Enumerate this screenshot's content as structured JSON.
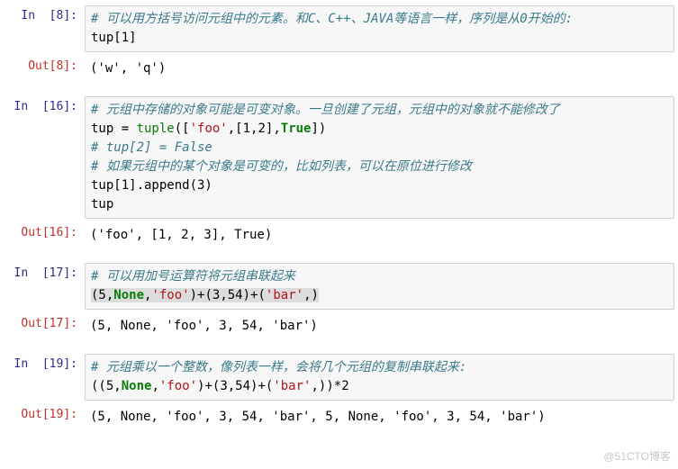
{
  "cells": {
    "c8": {
      "in_prompt": "In  [8]:",
      "out_prompt": "Out[8]:",
      "comment1": "# 可以用方括号访问元组中的元素。和C、C++、JAVA等语言一样，序列是从0开始的:",
      "line2": "tup[1]",
      "output": "('w', 'q')"
    },
    "c16": {
      "in_prompt": "In  [16]:",
      "out_prompt": "Out[16]:",
      "comment1": "# 元组中存储的对象可能是可变对象。一旦创建了元组，元组中的对象就不能修改了",
      "line2_a": "tup = ",
      "line2_func": "tuple",
      "line2_b": "([",
      "line2_str": "'foo'",
      "line2_c": ",[1,2],",
      "line2_true": "True",
      "line2_d": "])",
      "comment2": "# tup[2] = False",
      "comment3": "# 如果元组中的某个对象是可变的，比如列表，可以在原位进行修改",
      "line5": "tup[1].append(3)",
      "line6": "tup",
      "output": "('foo', [1, 2, 3], True)"
    },
    "c17": {
      "in_prompt": "In  [17]:",
      "out_prompt": "Out[17]:",
      "comment1": "# 可以用加号运算符将元组串联起来",
      "l2_a": "(5,",
      "l2_none": "None",
      "l2_b": ",",
      "l2_str1": "'foo'",
      "l2_c": ")+(3,54)+(",
      "l2_str2": "'bar'",
      "l2_d": ",)",
      "output": "(5, None, 'foo', 3, 54, 'bar')"
    },
    "c19": {
      "in_prompt": "In  [19]:",
      "out_prompt": "Out[19]:",
      "comment1": "# 元组乘以一个整数，像列表一样，会将几个元组的复制串联起来:",
      "l2_a": "((5,",
      "l2_none": "None",
      "l2_b": ",",
      "l2_str1": "'foo'",
      "l2_c": ")+(3,54)+(",
      "l2_str2": "'bar'",
      "l2_d": ",))*2",
      "output": "(5, None, 'foo', 3, 54, 'bar', 5, None, 'foo', 3, 54, 'bar')"
    }
  },
  "watermark": "@51CTO博客"
}
